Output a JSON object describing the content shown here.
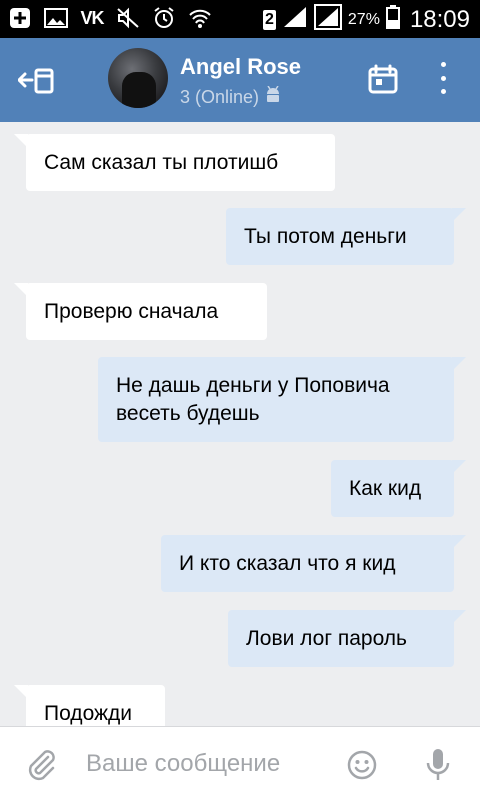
{
  "status_bar": {
    "carrier_icon": "vk-icon",
    "sim_number": "2",
    "battery_percent": "27%",
    "time": "18:09"
  },
  "header": {
    "contact_name": "Angel Rose",
    "contact_status": "3 (Online)",
    "back_icon": "back-icon",
    "calendar_icon": "calendar-icon",
    "menu_icon": "more-vertical-icon",
    "color": "#5181b8"
  },
  "messages": [
    {
      "direction": "in",
      "text": "Сам сказал ты плотишб"
    },
    {
      "direction": "out",
      "text": "Ты потом деньги"
    },
    {
      "direction": "in",
      "text": "Проверю сначала"
    },
    {
      "direction": "out",
      "text": "Не дашь деньги у Поповича весеть будешь"
    },
    {
      "direction": "out",
      "text": "Как кид"
    },
    {
      "direction": "out",
      "text": "И кто сказал что я кид"
    },
    {
      "direction": "out",
      "text": "Лови лог пароль"
    },
    {
      "direction": "in",
      "text": "Подожди"
    }
  ],
  "composer": {
    "placeholder": "Ваше сообщение",
    "attach_icon": "paperclip-icon",
    "emoji_icon": "smiley-icon",
    "mic_icon": "microphone-icon"
  },
  "colors": {
    "incoming_bubble": "#ffffff",
    "outgoing_bubble": "#dce8f6",
    "chat_background": "#edeef0"
  }
}
